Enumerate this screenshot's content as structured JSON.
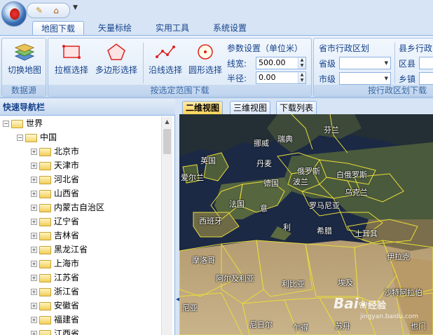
{
  "ribbon_tabs": [
    "地图下载",
    "矢量标绘",
    "实用工具",
    "系统设置"
  ],
  "groups": {
    "datasource": {
      "label": "数据源",
      "switch_map": "切换地图"
    },
    "range_download": {
      "label": "按选定范围下载",
      "rect_select": "拉框选择",
      "polygon_select": "多边形选择",
      "line_select": "沿线选择",
      "circle_select": "圆形选择",
      "params_title": "参数设置（单位米）",
      "line_width_label": "线宽:",
      "line_width_value": "500.00",
      "radius_label": "半径:",
      "radius_value": "0.00"
    },
    "admin_download": {
      "label": "按行政区划下载",
      "prov_city_title": "省市行政区划",
      "province_label": "省级",
      "city_label": "市级",
      "county_title": "县乡行政",
      "county_label": "区县",
      "town_label": "乡镇"
    }
  },
  "nav_panel": {
    "title": "快速导航栏",
    "world": "世界",
    "country": "中国",
    "provinces": [
      "北京市",
      "天津市",
      "河北省",
      "山西省",
      "内蒙古自治区",
      "辽宁省",
      "吉林省",
      "黑龙江省",
      "上海市",
      "江苏省",
      "浙江省",
      "安徽省",
      "福建省",
      "江西省"
    ]
  },
  "map_tabs": [
    "二维视图",
    "三维视图",
    "下载列表"
  ],
  "map_labels": {
    "finland": "芬兰",
    "norway": "挪威",
    "sweden": "瑞典",
    "uk": "英国",
    "ireland": "爱尔兰",
    "denmark": "丹麦",
    "russia": "俄罗斯",
    "belarus": "白俄罗斯",
    "germany": "德国",
    "poland": "波兰",
    "ukraine": "乌克兰",
    "france": "法国",
    "romania": "罗马尼亚",
    "spain": "西班牙",
    "italy": "意",
    "italy2": "利",
    "greece": "希腊",
    "turkey": "土耳其",
    "morocco": "摩洛哥",
    "algeria": "阿尔及利亚",
    "libya": "利比亚",
    "egypt": "埃及",
    "iran": "伊拉克",
    "saudi": "沙特阿拉伯",
    "mauritania": "尼亚",
    "niger": "尼日尔",
    "chad": "乍得",
    "sudan": "苏丹",
    "yemen": "也门"
  },
  "watermark": {
    "brand": "Bai",
    "brand2": "经验",
    "url": "jingyan.baidu.com"
  },
  "colors": {
    "ribbon": "#dbe8f7",
    "accent": "#15428b",
    "active_tab": "#ffd45a"
  }
}
